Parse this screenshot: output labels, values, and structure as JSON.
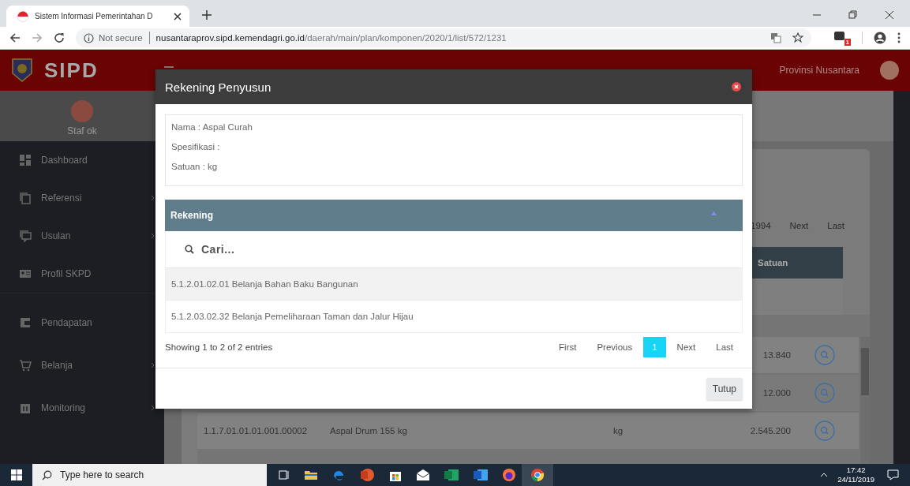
{
  "browser": {
    "tab": {
      "title": "Sistem Informasi Pemerintahan D"
    },
    "address": {
      "security": "Not secure",
      "host": "nusantaraprov.sipd.kemendagri.go.id",
      "path": "/daerah/main/plan/komponen/2020/1/list/572/1231"
    },
    "extension_badge": "1"
  },
  "app": {
    "logo": "SIPD",
    "region": "Provinsi Nusantara"
  },
  "sidebar": {
    "user": "Staf ok",
    "sections": [
      {
        "items": [
          {
            "label": "Dashboard",
            "has_submenu": false
          },
          {
            "label": "Referensi",
            "has_submenu": true
          },
          {
            "label": "Usulan",
            "has_submenu": true
          },
          {
            "label": "Profil SKPD",
            "has_submenu": false
          }
        ]
      },
      {
        "items": [
          {
            "label": "Pendapatan",
            "has_submenu": false
          },
          {
            "label": "Belanja",
            "has_submenu": true
          },
          {
            "label": "Monitoring",
            "has_submenu": true
          }
        ]
      }
    ]
  },
  "background": {
    "pagination": [
      {
        "label": "1994",
        "selected": false
      },
      {
        "label": "Next",
        "selected": false
      },
      {
        "label": "Last",
        "selected": false
      }
    ],
    "table": {
      "columns": [
        {
          "label": "Satuan"
        }
      ],
      "rows": [
        {
          "value": "13.840"
        },
        {
          "value": "12.000"
        },
        {
          "code": "1.1.7.01.01.01.001.00002",
          "name": "Aspal Drum 155 kg",
          "unit": "kg",
          "value": "2.545.200"
        }
      ]
    }
  },
  "modal": {
    "title": "Rekening Penyusun",
    "details": [
      "Nama : Aspal Curah",
      "Spesifikasi :",
      "Satuan : kg"
    ],
    "table": {
      "column": "Rekening",
      "search": {
        "placeholder": "Cari..."
      },
      "rows": [
        "5.1.2.01.02.01 Belanja Bahan Baku Bangunan",
        "5.1.2.03.02.32 Belanja Pemeliharaan Taman dan Jalur Hijau"
      ],
      "info": "Showing 1 to 2 of 2 entries",
      "pagination": [
        {
          "label": "First",
          "selected": false
        },
        {
          "label": "Previous",
          "selected": false
        },
        {
          "label": "1",
          "selected": true
        },
        {
          "label": "Next",
          "selected": false
        },
        {
          "label": "Last",
          "selected": false
        }
      ]
    },
    "close_button": "Tutup"
  },
  "taskbar": {
    "search": {
      "placeholder": "Type here to search"
    },
    "time": "17:42",
    "date": "24/11/2019"
  }
}
